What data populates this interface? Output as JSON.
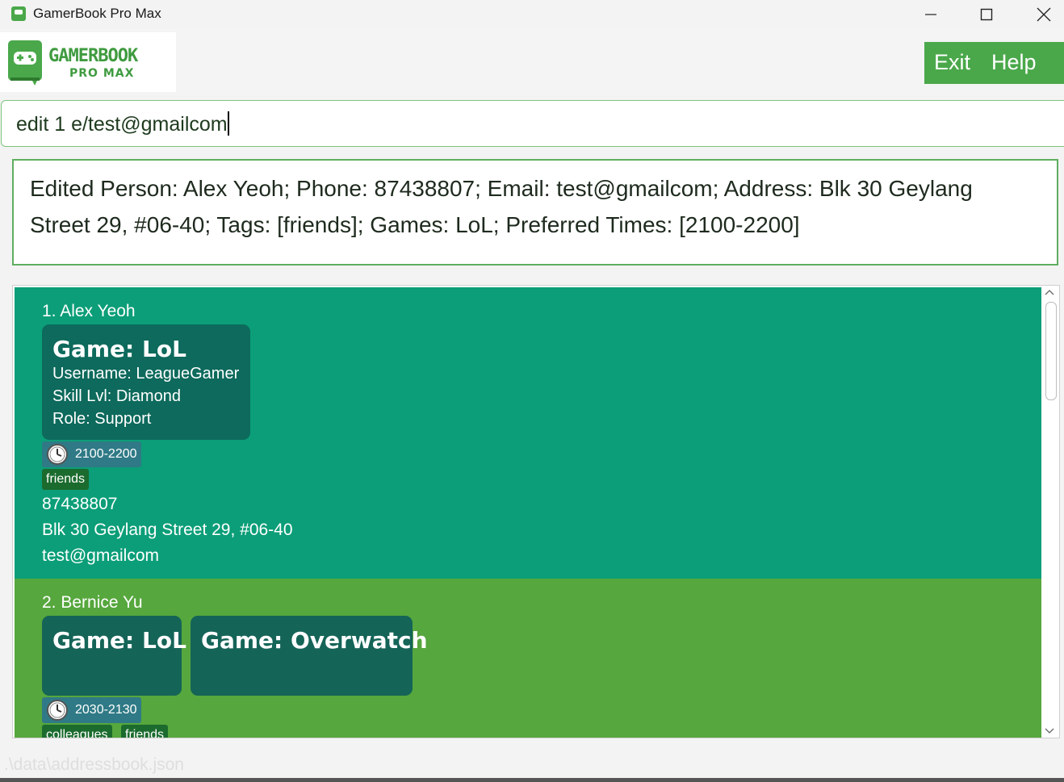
{
  "window": {
    "title": "GamerBook Pro Max"
  },
  "logo": {
    "line1": "GAMERBOOK",
    "line2": "PRO MAX"
  },
  "menu": {
    "exit": "Exit",
    "help": "Help"
  },
  "command": {
    "value": "edit 1 e/test@gmailcom"
  },
  "result": {
    "text": "Edited Person: Alex Yeoh; Phone: 87438807; Email: test@gmailcom; Address: Blk 30 Geylang Street 29, #06-40; Tags: [friends]; Games: LoL; Preferred Times: [2100-2200]"
  },
  "persons": [
    {
      "name": "1. Alex Yeoh",
      "games": [
        {
          "title": "Game: LoL",
          "username": "Username: LeagueGamer",
          "skill": "Skill Lvl: Diamond",
          "role": "Role: Support"
        }
      ],
      "time": "2100-2200",
      "tags": [
        "friends"
      ],
      "phone": "87438807",
      "address": "Blk 30 Geylang Street 29, #06-40",
      "email": "test@gmailcom"
    },
    {
      "name": "2. Bernice Yu",
      "games": [
        {
          "title": "Game: LoL"
        },
        {
          "title": "Game: Overwatch"
        }
      ],
      "time": "2030-2130",
      "tags": [
        "colleagues",
        "friends"
      ]
    }
  ],
  "status": {
    "path": ".\\data\\addressbook.json"
  },
  "colors": {
    "accent": "#4aa84a",
    "card1": "#0b9e78",
    "card2": "#56a73d",
    "gameBox1": "#0d6a5c",
    "gameBox2": "#156458"
  }
}
